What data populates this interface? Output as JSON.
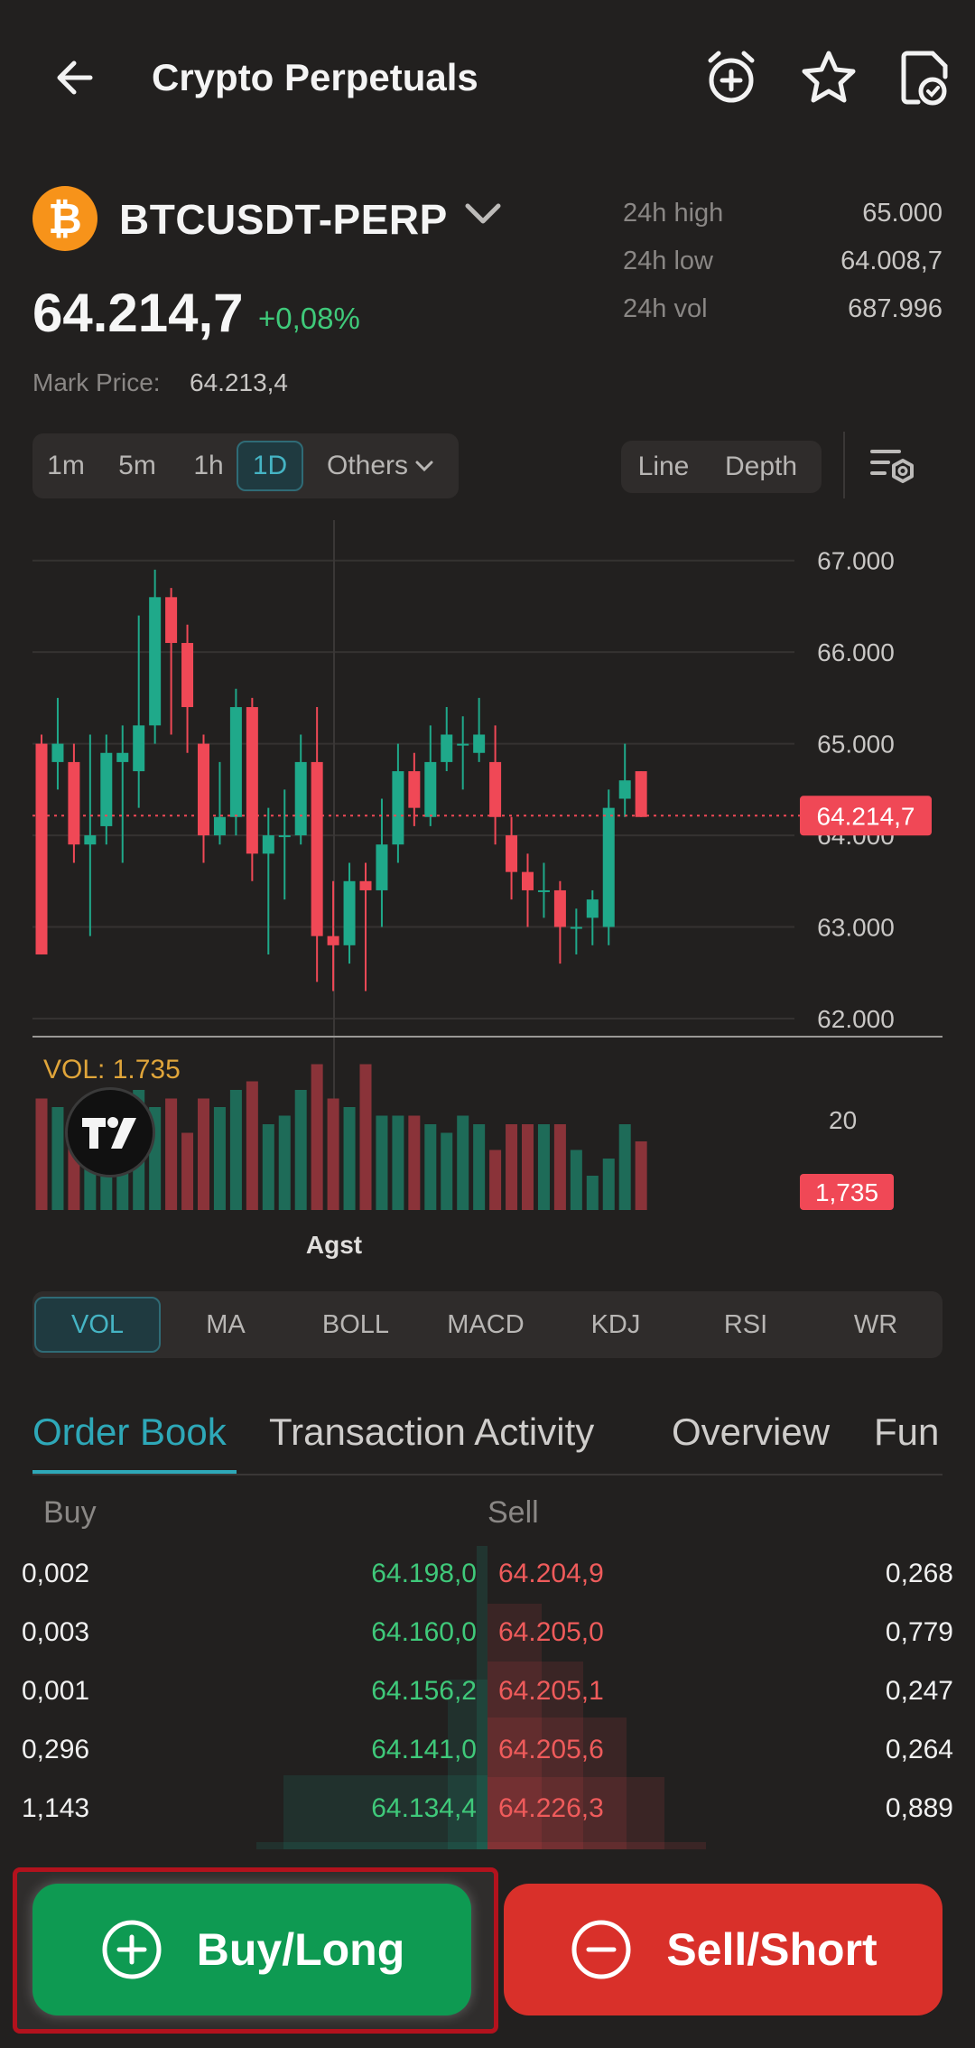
{
  "header": {
    "title": "Crypto Perpetuals",
    "icons": [
      "back-arrow-icon",
      "price-alert-icon",
      "star-icon",
      "share-icon"
    ]
  },
  "instrument": {
    "symbol": "BTCUSDT-PERP",
    "coin_glyph": "₿",
    "last_price": "64.214,7",
    "change_pct": "+0,08%",
    "mark_price_label": "Mark Price:",
    "mark_price": "64.213,4",
    "stats": [
      {
        "label": "24h high",
        "value": "65.000"
      },
      {
        "label": "24h low",
        "value": "64.008,7"
      },
      {
        "label": "24h vol",
        "value": "687.996"
      }
    ]
  },
  "intervals": [
    {
      "label": "1m",
      "active": false
    },
    {
      "label": "5m",
      "active": false
    },
    {
      "label": "1h",
      "active": false
    },
    {
      "label": "1D",
      "active": true
    },
    {
      "label": "Others",
      "active": false
    }
  ],
  "chart_modes": [
    "Line",
    "Depth"
  ],
  "chart_data": {
    "type": "candlestick",
    "y_ticks": [
      "67.000",
      "66.000",
      "65.000",
      "64.000",
      "63.000",
      "62.000"
    ],
    "ylim": [
      61980,
      67500
    ],
    "last_price_label": "64.214,7",
    "last_price": 64214.7,
    "x_label": "Agst",
    "volume_label": "VOL: 1.735",
    "volume_tick": "20",
    "volume_last_label": "1,735",
    "candles": [
      {
        "o": 65000,
        "c": 62700,
        "h": 65100,
        "l": 62700
      },
      {
        "o": 64800,
        "c": 65000,
        "h": 65500,
        "l": 64500
      },
      {
        "o": 64800,
        "c": 63900,
        "h": 65000,
        "l": 63700
      },
      {
        "o": 63900,
        "c": 64000,
        "h": 65100,
        "l": 62900
      },
      {
        "o": 64100,
        "c": 64900,
        "h": 65100,
        "l": 63900
      },
      {
        "o": 64800,
        "c": 64900,
        "h": 65200,
        "l": 63700
      },
      {
        "o": 64700,
        "c": 65200,
        "h": 66400,
        "l": 64300
      },
      {
        "o": 65200,
        "c": 66600,
        "h": 66900,
        "l": 65000
      },
      {
        "o": 66600,
        "c": 66100,
        "h": 66700,
        "l": 65100
      },
      {
        "o": 66100,
        "c": 65400,
        "h": 66300,
        "l": 64900
      },
      {
        "o": 65000,
        "c": 64000,
        "h": 65100,
        "l": 63700
      },
      {
        "o": 64000,
        "c": 64200,
        "h": 64800,
        "l": 63900
      },
      {
        "o": 64200,
        "c": 65400,
        "h": 65600,
        "l": 64000
      },
      {
        "o": 65400,
        "c": 63800,
        "h": 65500,
        "l": 63500
      },
      {
        "o": 63800,
        "c": 64000,
        "h": 64300,
        "l": 62700
      },
      {
        "o": 64000,
        "c": 64000,
        "h": 64500,
        "l": 63300
      },
      {
        "o": 64000,
        "c": 64800,
        "h": 65100,
        "l": 63900
      },
      {
        "o": 64800,
        "c": 62900,
        "h": 65400,
        "l": 62400
      },
      {
        "o": 62900,
        "c": 62800,
        "h": 63500,
        "l": 62300
      },
      {
        "o": 62800,
        "c": 63500,
        "h": 63700,
        "l": 62600
      },
      {
        "o": 63500,
        "c": 63400,
        "h": 63700,
        "l": 62300
      },
      {
        "o": 63400,
        "c": 63900,
        "h": 64400,
        "l": 63000
      },
      {
        "o": 63900,
        "c": 64700,
        "h": 65000,
        "l": 63700
      },
      {
        "o": 64700,
        "c": 64300,
        "h": 64900,
        "l": 64100
      },
      {
        "o": 64200,
        "c": 64800,
        "h": 65200,
        "l": 64100
      },
      {
        "o": 64800,
        "c": 65100,
        "h": 65400,
        "l": 64700
      },
      {
        "o": 65000,
        "c": 65000,
        "h": 65300,
        "l": 64500
      },
      {
        "o": 64900,
        "c": 65100,
        "h": 65500,
        "l": 64800
      },
      {
        "o": 64800,
        "c": 64200,
        "h": 65200,
        "l": 63900
      },
      {
        "o": 64000,
        "c": 63600,
        "h": 64200,
        "l": 63300
      },
      {
        "o": 63600,
        "c": 63400,
        "h": 63800,
        "l": 63000
      },
      {
        "o": 63400,
        "c": 63400,
        "h": 63700,
        "l": 63100
      },
      {
        "o": 63400,
        "c": 63000,
        "h": 63500,
        "l": 62600
      },
      {
        "o": 63000,
        "c": 63000,
        "h": 63200,
        "l": 62700
      },
      {
        "o": 63100,
        "c": 63300,
        "h": 63400,
        "l": 62800
      },
      {
        "o": 63000,
        "c": 64300,
        "h": 64500,
        "l": 62800
      },
      {
        "o": 64400,
        "c": 64600,
        "h": 65000,
        "l": 64200
      },
      {
        "o": 64700,
        "c": 64200,
        "h": 64700,
        "l": 64200
      }
    ],
    "volumes": [
      13,
      12,
      11,
      8,
      11,
      13,
      14,
      12,
      13,
      9,
      13,
      12,
      14,
      15,
      10,
      11,
      14,
      17,
      13,
      12,
      17,
      11,
      11,
      11,
      10,
      9,
      11,
      10,
      7,
      10,
      10,
      10,
      10,
      7,
      4,
      6,
      10,
      8
    ]
  },
  "indicators": [
    {
      "label": "VOL",
      "active": true
    },
    {
      "label": "MA",
      "active": false
    },
    {
      "label": "BOLL",
      "active": false
    },
    {
      "label": "MACD",
      "active": false
    },
    {
      "label": "KDJ",
      "active": false
    },
    {
      "label": "RSI",
      "active": false
    },
    {
      "label": "WR",
      "active": false
    }
  ],
  "bottom_tabs": [
    {
      "label": "Order Book",
      "active": true
    },
    {
      "label": "Transaction Activity",
      "active": false
    },
    {
      "label": "Overview",
      "active": false
    },
    {
      "label": "Fun",
      "active": false
    }
  ],
  "order_book": {
    "buy_header": "Buy",
    "sell_header": "Sell",
    "rows": [
      {
        "buy_qty": "0,002",
        "buy_price": "64.198,0",
        "sell_price": "64.204,9",
        "sell_qty": "0,268"
      },
      {
        "buy_qty": "0,003",
        "buy_price": "64.160,0",
        "sell_price": "64.205,0",
        "sell_qty": "0,779"
      },
      {
        "buy_qty": "0,001",
        "buy_price": "64.156,2",
        "sell_price": "64.205,1",
        "sell_qty": "0,247"
      },
      {
        "buy_qty": "0,296",
        "buy_price": "64.141,0",
        "sell_price": "64.205,6",
        "sell_qty": "0,264"
      },
      {
        "buy_qty": "1,143",
        "buy_price": "64.134,4",
        "sell_price": "64.226,3",
        "sell_qty": "0,889"
      }
    ]
  },
  "actions": {
    "buy_label": "Buy/Long",
    "sell_label": "Sell/Short"
  },
  "colors": {
    "up": "#1fa98a",
    "down": "#f04856",
    "accent": "#2ea8b8",
    "buy_button": "#0e9a52",
    "sell_button": "#d9302a"
  }
}
